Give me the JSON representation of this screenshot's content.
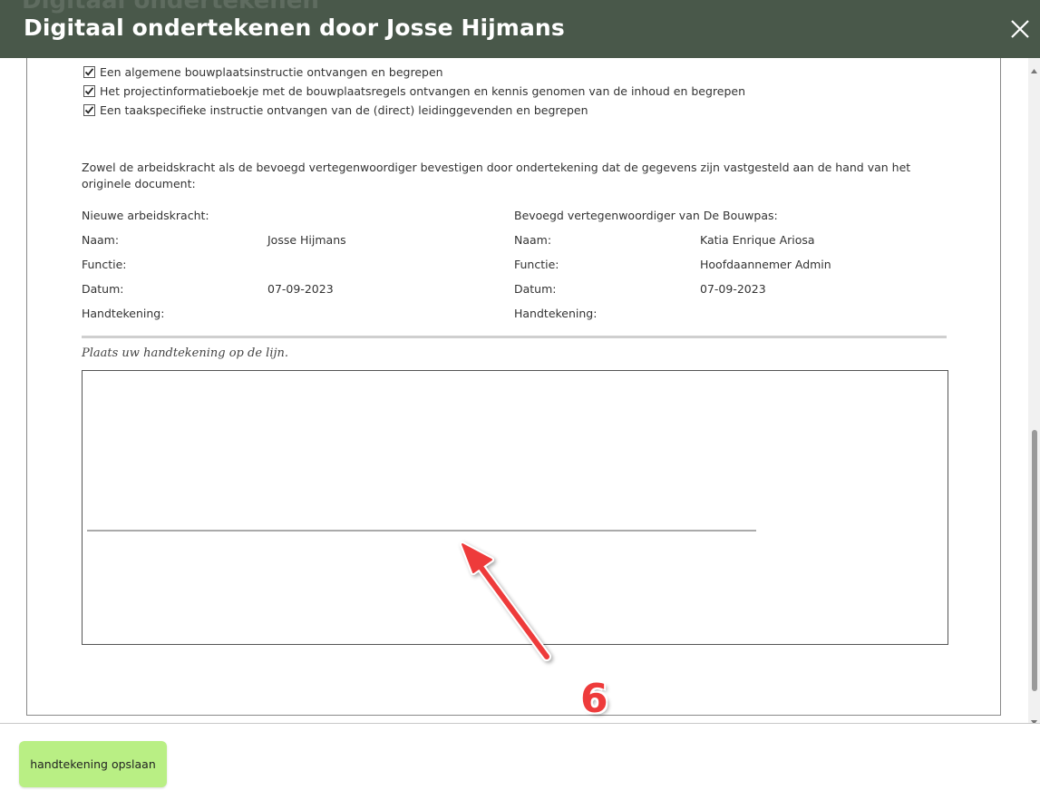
{
  "dialog": {
    "title": "Digitaal ondertekenen door Josse Hijmans",
    "background_ghost_text": "Digitaal ondertekenen"
  },
  "checklist": [
    {
      "label": "Een algemene bouwplaatsinstructie ontvangen en begrepen",
      "checked": true
    },
    {
      "label": "Het projectinformatieboekje met de bouwplaatsregels ontvangen en kennis genomen van de inhoud en begrepen",
      "checked": true
    },
    {
      "label": "Een taakspecifieke instructie ontvangen van de (direct) leidinggevenden en begrepen",
      "checked": true
    }
  ],
  "confirmation_text": "Zowel de arbeidskracht als de bevoegd vertegenwoordiger bevestigen door ondertekening dat de gegevens zijn vastgesteld aan de hand van het originele document:",
  "worker": {
    "heading": "Nieuwe arbeidskracht:",
    "name_label": "Naam:",
    "name_value": "Josse Hijmans",
    "function_label": "Functie:",
    "function_value": "",
    "date_label": "Datum:",
    "date_value": "07-09-2023",
    "signature_label": "Handtekening:"
  },
  "representative": {
    "heading": "Bevoegd vertegenwoordiger van De Bouwpas:",
    "name_label": "Naam:",
    "name_value": "Katia Enrique Ariosa",
    "function_label": "Functie:",
    "function_value": "Hoofdaannemer Admin",
    "date_label": "Datum:",
    "date_value": "07-09-2023",
    "signature_label": "Handtekening:"
  },
  "signature_pad": {
    "hint": "Plaats uw handtekening op de lijn."
  },
  "annotation": {
    "step_number": "6",
    "color": "#ee3b3b"
  },
  "footer": {
    "save_label": "handtekening opslaan"
  },
  "colors": {
    "title_bar": "#49584a",
    "save_button": "#b9ef84"
  }
}
